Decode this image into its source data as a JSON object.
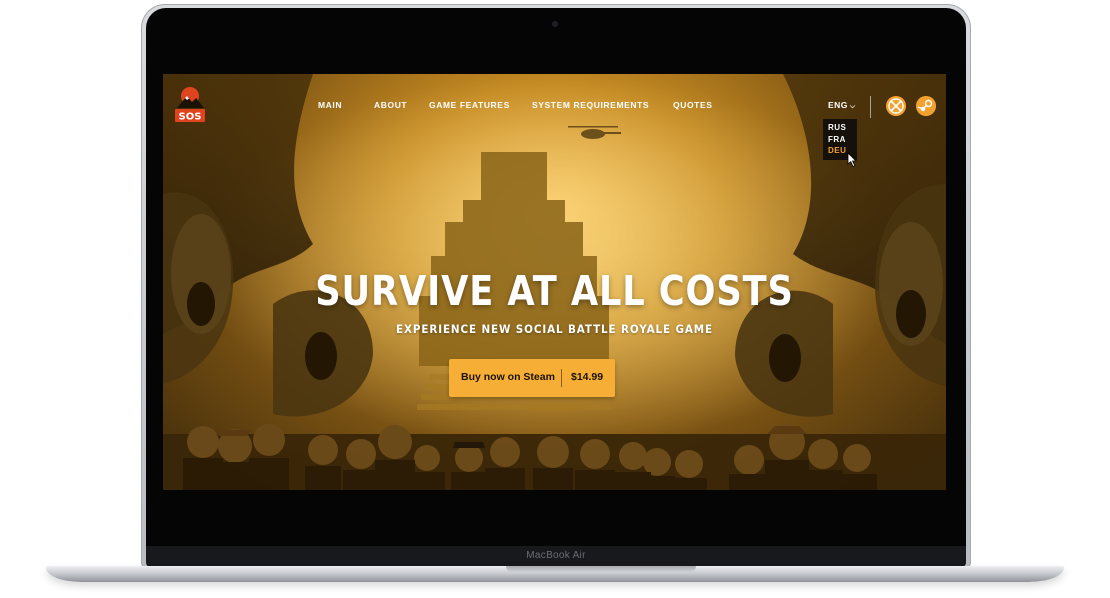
{
  "device": {
    "model_label": "MacBook Air"
  },
  "site": {
    "logo_text": "SOS",
    "nav": [
      {
        "label": "MAIN"
      },
      {
        "label": "ABOUT"
      },
      {
        "label": "GAME FEATURES"
      },
      {
        "label": "SYSTEM REQUIREMENTS"
      },
      {
        "label": "QUOTES"
      }
    ],
    "language": {
      "current": "ENG",
      "options": [
        "RUS",
        "FRA",
        "DEU"
      ],
      "hovered": "DEU"
    },
    "platform_icons": [
      "xbox-icon",
      "steam-icon"
    ]
  },
  "hero": {
    "title": "SURVIVE AT ALL COSTS",
    "subtitle": "EXPERIENCE NEW SOCIAL BATTLE ROYALE GAME",
    "cta_label": "Buy now on Steam",
    "price": "$14.99"
  },
  "colors": {
    "accent": "#f6ae36",
    "screen_bg": "#c58a22",
    "dropdown_bg": "#15110a",
    "text": "#ffffff"
  }
}
